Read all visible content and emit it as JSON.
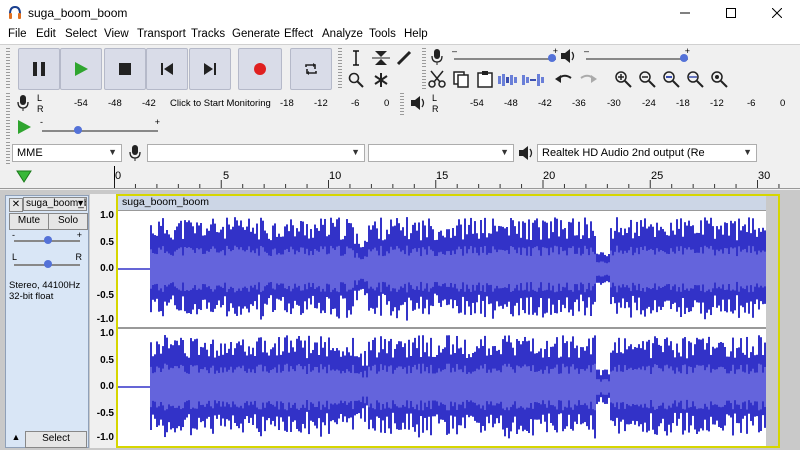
{
  "window": {
    "title": "suga_boom_boom",
    "controls": [
      "minimize",
      "maximize",
      "close"
    ]
  },
  "menu": [
    "File",
    "Edit",
    "Select",
    "View",
    "Transport",
    "Tracks",
    "Generate",
    "Effect",
    "Analyze",
    "Tools",
    "Help"
  ],
  "transport": [
    "pause",
    "play",
    "stop",
    "skip-start",
    "skip-end",
    "record",
    "loop"
  ],
  "tools": {
    "row1": [
      "selection-tool",
      "envelope-tool",
      "draw-tool"
    ],
    "row2": [
      "zoom-tool",
      "multi-tool"
    ]
  },
  "recording_meter": {
    "l": "L",
    "r": "R",
    "scale": [
      "-54",
      "-48",
      "-42",
      "Click to Start Monitoring",
      "-18",
      "-12",
      "-6",
      "0"
    ]
  },
  "playback_meter": {
    "l": "L",
    "r": "R",
    "scale": [
      "-54",
      "-48",
      "-42",
      "-36",
      "-30",
      "-24",
      "-18",
      "-12",
      "-6",
      "0"
    ]
  },
  "play_at_speed": {
    "minus": "-",
    "plus": "+"
  },
  "device": {
    "host": "MME",
    "input": "",
    "channels": "",
    "output": "Realtek HD Audio 2nd output (Re"
  },
  "timeline": {
    "labels": [
      "0",
      "5",
      "10",
      "15",
      "20",
      "25",
      "30"
    ]
  },
  "track": {
    "name": "suga_boom_boom",
    "clip_name": "suga_boom_boom",
    "mute": "Mute",
    "solo": "Solo",
    "gain_minus": "-",
    "gain_plus": "+",
    "pan_l": "L",
    "pan_r": "R",
    "info_line1": "Stereo, 44100Hz",
    "info_line2": "32-bit float",
    "select": "Select",
    "ruler": [
      "1.0",
      "0.5",
      "0.0",
      "-0.5",
      "-1.0"
    ]
  },
  "colors": {
    "waveform": "#3232c8",
    "waveform_rms": "#6464dc",
    "clip_bg": "#ffffff",
    "track_panel": "#d9e6f6",
    "selection_border": "#d6d600"
  }
}
